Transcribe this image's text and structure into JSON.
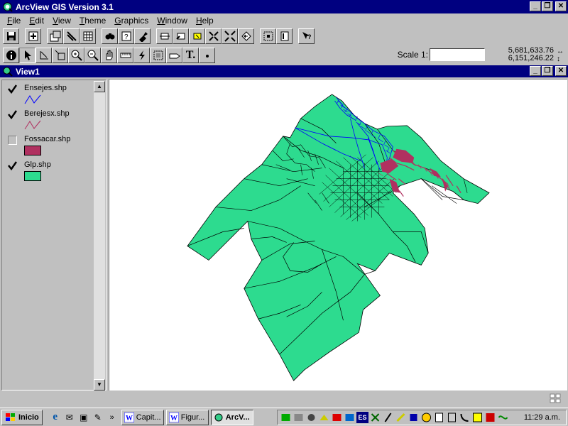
{
  "app": {
    "title": "ArcView GIS Version 3.1",
    "menu": [
      "File",
      "Edit",
      "View",
      "Theme",
      "Graphics",
      "Window",
      "Help"
    ],
    "menu_underline": [
      "F",
      "E",
      "V",
      "T",
      "G",
      "W",
      "H"
    ]
  },
  "toolbar1": [
    "save-icon",
    "add-theme-icon",
    "theme-properties-icon",
    "edit-legend-icon",
    "open-table-icon",
    "find-icon",
    "query-builder-icon",
    "locate-address-icon",
    "zoom-full-extent-icon",
    "zoom-active-theme-icon",
    "zoom-selected-icon",
    "zoom-in-fixed-icon",
    "zoom-out-fixed-icon",
    "zoom-previous-icon",
    "select-by-theme-icon",
    "clear-selection-icon",
    "help-icon"
  ],
  "toolbar2": [
    "identify-icon",
    "pointer-icon",
    "vertex-edit-icon",
    "select-feature-icon",
    "zoom-in-icon",
    "zoom-out-icon",
    "pan-icon",
    "measure-icon",
    "hotlink-icon",
    "area-of-interest-icon",
    "label-icon",
    "text-icon",
    "draw-point-icon"
  ],
  "scale": {
    "label": "Scale 1:",
    "value": ""
  },
  "coords": {
    "x": "5,681,633.76",
    "y": "6,151,246.22"
  },
  "view": {
    "title": "View1"
  },
  "themes": [
    {
      "name": "Ensejes.shp",
      "checked": true,
      "symbol": "line",
      "color": "#0000ff"
    },
    {
      "name": "Berejesx.shp",
      "checked": true,
      "symbol": "line",
      "color": "#b03060"
    },
    {
      "name": "Fossacar.shp",
      "checked": false,
      "symbol": "fill",
      "color": "#b03060"
    },
    {
      "name": "Glp.shp",
      "checked": true,
      "symbol": "fill",
      "color": "#2ddb8f"
    }
  ],
  "colors": {
    "polygon_fill": "#2ddb8f",
    "roads_blue": "#0000ff",
    "magenta": "#b03060",
    "title_blue": "#000080"
  },
  "taskbar": {
    "start_label": "Inicio",
    "tasks": [
      {
        "label": "Capit...",
        "icon": "word-icon",
        "active": false
      },
      {
        "label": "Figur...",
        "icon": "word-icon",
        "active": false
      },
      {
        "label": "ArcV...",
        "icon": "arcview-icon",
        "active": true
      }
    ],
    "tray_lang": "ES",
    "clock": "11:29 a.m."
  }
}
